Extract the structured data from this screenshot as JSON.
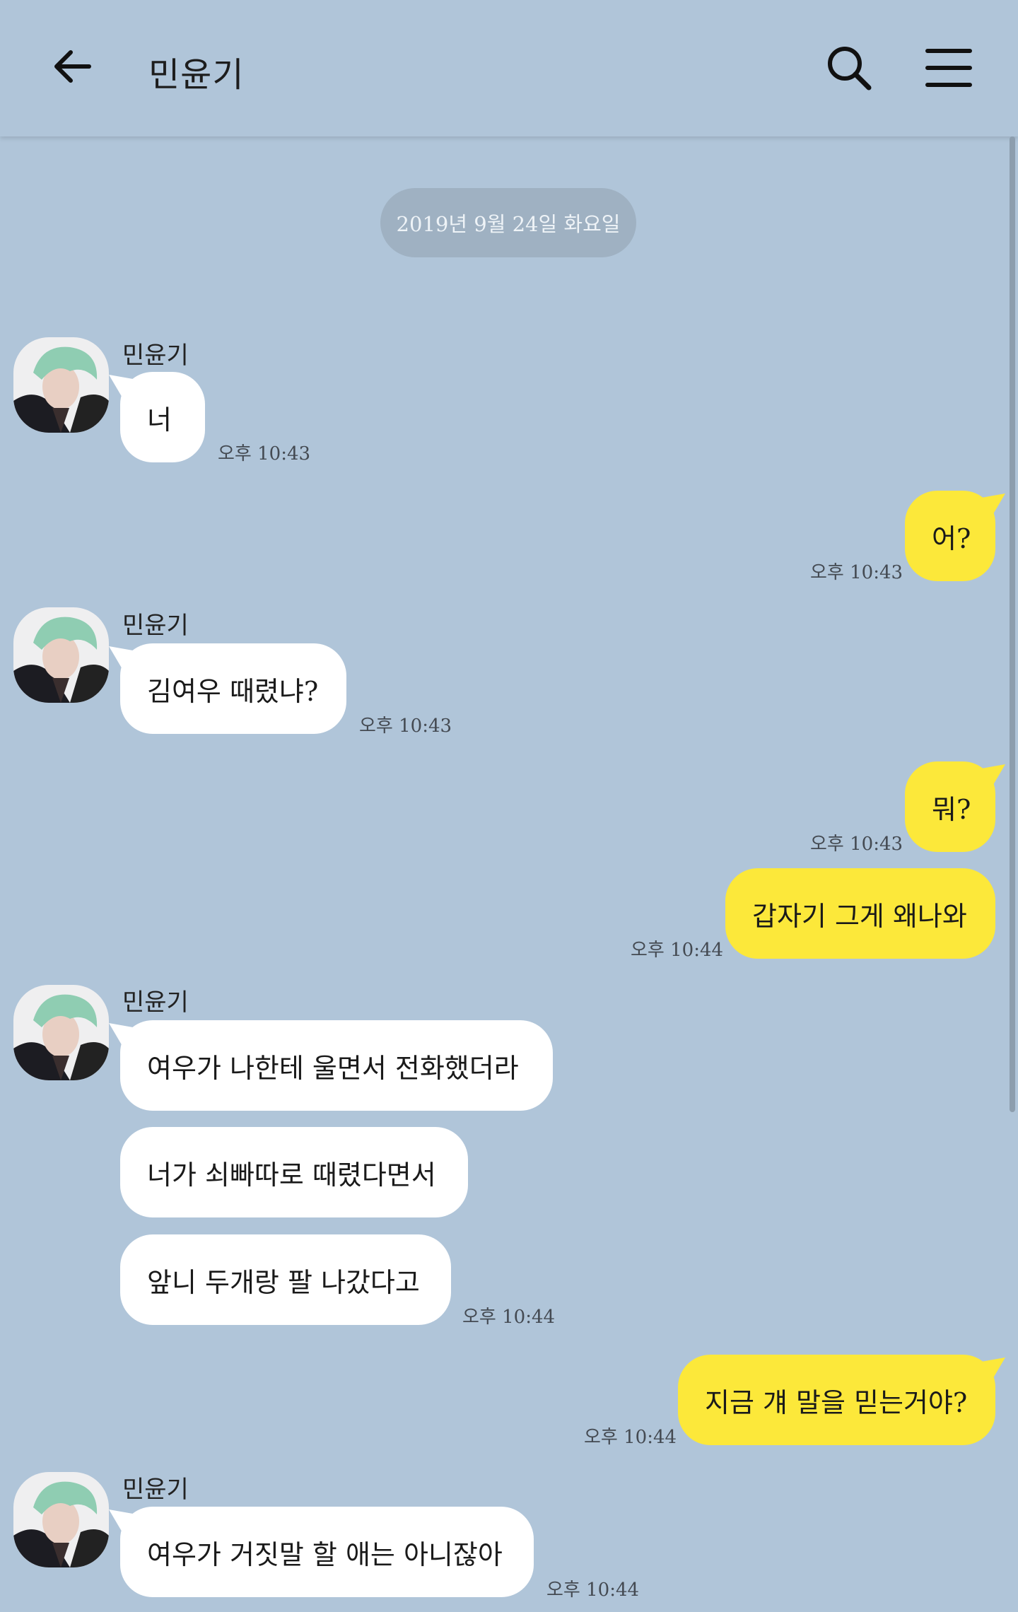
{
  "header": {
    "title": "민윤기",
    "back_icon": "arrow-left-icon",
    "search_icon": "search-icon",
    "menu_icon": "hamburger-menu-icon"
  },
  "date_divider": "2019년 9월 24일 화요일",
  "colors": {
    "background": "#b0c5d9",
    "incoming_bubble": "#ffffff",
    "outgoing_bubble": "#fce83a"
  },
  "messages": [
    {
      "direction": "incoming",
      "sender": "민윤기",
      "text": "너",
      "time": "오후 10:43"
    },
    {
      "direction": "outgoing",
      "text": "어?",
      "time": "오후 10:43"
    },
    {
      "direction": "incoming",
      "sender": "민윤기",
      "text": "김여우 때렸냐?",
      "time": "오후 10:43"
    },
    {
      "direction": "outgoing",
      "text": "뭐?",
      "time": "오후 10:43"
    },
    {
      "direction": "outgoing",
      "text": "갑자기 그게 왜나와",
      "time": "오후 10:44"
    },
    {
      "direction": "incoming",
      "sender": "민윤기",
      "text": "여우가 나한테 울면서 전화했더라"
    },
    {
      "direction": "incoming",
      "text": "너가 쇠빠따로 때렸다면서"
    },
    {
      "direction": "incoming",
      "text": "앞니 두개랑 팔 나갔다고",
      "time": "오후 10:44"
    },
    {
      "direction": "outgoing",
      "text": "지금 걔 말을 믿는거야?",
      "time": "오후 10:44"
    },
    {
      "direction": "incoming",
      "sender": "민윤기",
      "text": "여우가 거짓말 할 애는 아니잖아",
      "time": "오후 10:44"
    }
  ]
}
